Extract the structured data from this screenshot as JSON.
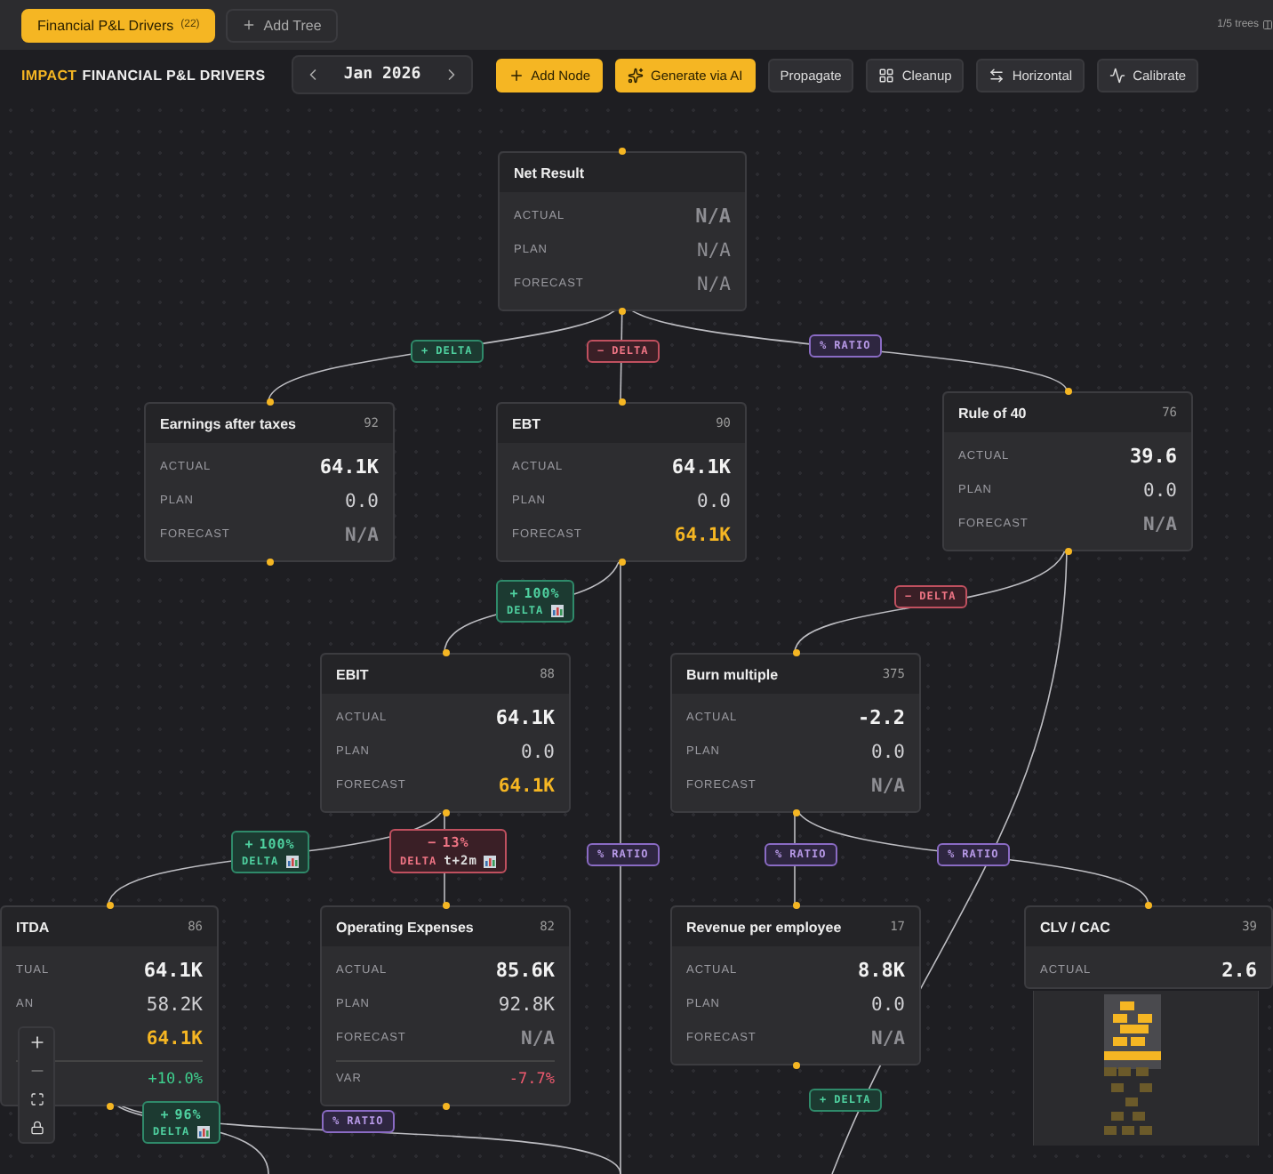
{
  "tabs": [
    {
      "label": "Financial P&L Drivers",
      "count": "(22)",
      "selected": true
    }
  ],
  "add_tree": {
    "label": "Add Tree"
  },
  "tree_counter": "1/5 trees",
  "toolbar": {
    "title_prefix": "IMPACT",
    "title": "FINANCIAL P&L DRIVERS",
    "period": "Jan 2026",
    "buttons": [
      {
        "label": "Add Node",
        "kind": "primary"
      },
      {
        "label": "Generate via AI",
        "kind": "primary"
      },
      {
        "label": "Propagate",
        "kind": "secondary"
      },
      {
        "label": "Cleanup",
        "kind": "secondary"
      },
      {
        "label": "Horizontal",
        "kind": "secondary"
      },
      {
        "label": "Calibrate",
        "kind": "secondary"
      }
    ]
  },
  "nodes": [
    {
      "title": "Net Result",
      "rows": [
        {
          "label": "ACTUAL",
          "value": "N/A",
          "color": "#8e8e93"
        },
        {
          "label": "PLAN",
          "value": "N/A",
          "color": "#8e8e93"
        },
        {
          "label": "FORECAST",
          "value": "N/A",
          "color": "#8e8e93"
        }
      ]
    },
    {
      "title": "Earnings after taxes",
      "number": "92",
      "rows": [
        {
          "label": "ACTUAL",
          "value": "64.1K",
          "color": "#f2f2f2"
        },
        {
          "label": "PLAN",
          "value": "0.0",
          "color": "#cfcfd2"
        },
        {
          "label": "FORECAST",
          "value": "N/A",
          "color": "#8e8e93"
        }
      ]
    },
    {
      "title": "EBT",
      "number": "90",
      "rows": [
        {
          "label": "ACTUAL",
          "value": "64.1K",
          "color": "#f2f2f2"
        },
        {
          "label": "PLAN",
          "value": "0.0",
          "color": "#cfcfd2"
        },
        {
          "label": "FORECAST",
          "value": "64.1K",
          "color": "#f5b623"
        }
      ]
    },
    {
      "title": "Rule of 40",
      "number": "76",
      "rows": [
        {
          "label": "ACTUAL",
          "value": "39.6",
          "color": "#f2f2f2"
        },
        {
          "label": "PLAN",
          "value": "0.0",
          "color": "#cfcfd2"
        },
        {
          "label": "FORECAST",
          "value": "N/A",
          "color": "#8e8e93"
        }
      ]
    },
    {
      "title": "EBIT",
      "number": "88",
      "rows": [
        {
          "label": "ACTUAL",
          "value": "64.1K",
          "color": "#f2f2f2"
        },
        {
          "label": "PLAN",
          "value": "0.0",
          "color": "#cfcfd2"
        },
        {
          "label": "FORECAST",
          "value": "64.1K",
          "color": "#f5b623"
        }
      ]
    },
    {
      "title": "Burn multiple",
      "number": "375",
      "rows": [
        {
          "label": "ACTUAL",
          "value": "-2.2",
          "color": "#f2f2f2"
        },
        {
          "label": "PLAN",
          "value": "0.0",
          "color": "#cfcfd2"
        },
        {
          "label": "FORECAST",
          "value": "N/A",
          "color": "#8e8e93"
        }
      ]
    },
    {
      "title": "ITDA",
      "number": "86",
      "rows": [
        {
          "label": "TUAL",
          "value": "64.1K",
          "color": "#f2f2f2"
        },
        {
          "label": "AN",
          "value": "58.2K",
          "color": "#cfcfd2"
        },
        {
          "value": "64.1K",
          "color": "#f5b623"
        }
      ],
      "variance": {
        "value": "+10.0%",
        "color": "#3ecf8e"
      }
    },
    {
      "title": "Operating Expenses",
      "number": "82",
      "rows": [
        {
          "label": "ACTUAL",
          "value": "85.6K",
          "color": "#f2f2f2"
        },
        {
          "label": "PLAN",
          "value": "92.8K",
          "color": "#cfcfd2"
        },
        {
          "label": "FORECAST",
          "value": "N/A",
          "color": "#8e8e93"
        }
      ],
      "variance": {
        "label": "VAR",
        "value": "-7.7%",
        "color": "#ef5a6f"
      }
    },
    {
      "title": "Revenue per employee",
      "number": "17",
      "rows": [
        {
          "label": "ACTUAL",
          "value": "8.8K",
          "color": "#f2f2f2"
        },
        {
          "label": "PLAN",
          "value": "0.0",
          "color": "#cfcfd2"
        },
        {
          "label": "FORECAST",
          "value": "N/A",
          "color": "#8e8e93"
        }
      ]
    },
    {
      "title": "CLV / CAC",
      "number": "39",
      "rows": [
        {
          "label": "ACTUAL",
          "value": "2.6",
          "color": "#f2f2f2"
        }
      ]
    }
  ],
  "edge_labels": [
    {
      "kind": "positive",
      "sign": "+",
      "label": "DELTA"
    },
    {
      "kind": "negative",
      "sign": "−",
      "label": "DELTA"
    },
    {
      "kind": "ratio",
      "sign": "%",
      "label": "RATIO"
    },
    {
      "kind": "positive",
      "sign": "+",
      "value": "100%",
      "label": "DELTA",
      "chart": true
    },
    {
      "kind": "negative",
      "sign": "−",
      "label": "DELTA"
    },
    {
      "kind": "positive",
      "sign": "+",
      "value": "100%",
      "label": "DELTA",
      "chart": true
    },
    {
      "kind": "negative",
      "sign": "−",
      "value": "13%",
      "label": "DELTA",
      "lag": "t+2m",
      "chart": true
    },
    {
      "kind": "ratio",
      "sign": "%",
      "label": "RATIO"
    },
    {
      "kind": "ratio",
      "sign": "%",
      "label": "RATIO"
    },
    {
      "kind": "ratio",
      "sign": "%",
      "label": "RATIO"
    },
    {
      "kind": "positive",
      "sign": "+",
      "value": "96%",
      "label": "DELTA",
      "chart": true
    },
    {
      "kind": "ratio",
      "sign": "%",
      "label": "RATIO"
    },
    {
      "kind": "positive",
      "sign": "+",
      "label": "DELTA"
    }
  ]
}
